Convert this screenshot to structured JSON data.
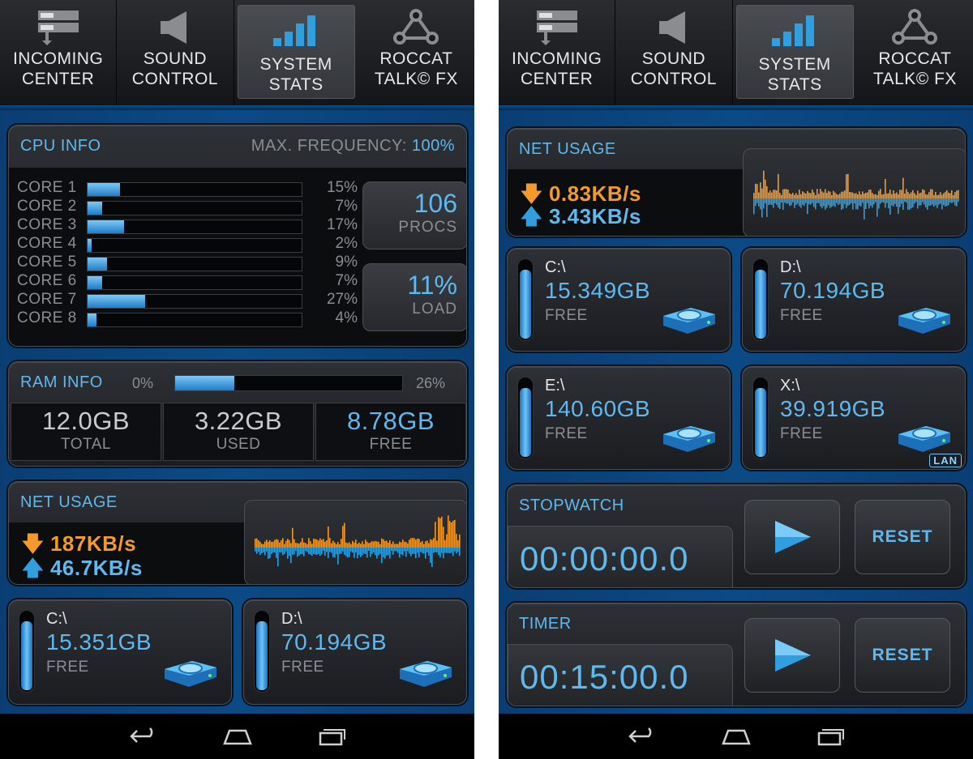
{
  "tabs": [
    {
      "line1": "INCOMING",
      "line2": "CENTER",
      "icon": "server-icon"
    },
    {
      "line1": "SOUND",
      "line2": "CONTROL",
      "icon": "speaker-icon"
    },
    {
      "line1": "SYSTEM",
      "line2": "STATS",
      "icon": "bar-chart-icon",
      "active": true
    },
    {
      "line1": "ROCCAT",
      "line2": "TALK© FX",
      "icon": "network-nodes-icon"
    }
  ],
  "left": {
    "cpu": {
      "title": "CPU INFO",
      "freq_label": "MAX. FREQUENCY:",
      "freq_value": "100%",
      "cores": [
        {
          "name": "CORE 1",
          "pct_text": "15%",
          "value": 15
        },
        {
          "name": "CORE 2",
          "pct_text": "7%",
          "value": 7
        },
        {
          "name": "CORE 3",
          "pct_text": "17%",
          "value": 17
        },
        {
          "name": "CORE 4",
          "pct_text": "2%",
          "value": 2
        },
        {
          "name": "CORE 5",
          "pct_text": "9%",
          "value": 9
        },
        {
          "name": "CORE 6",
          "pct_text": "7%",
          "value": 7
        },
        {
          "name": "CORE 7",
          "pct_text": "27%",
          "value": 27
        },
        {
          "name": "CORE 8",
          "pct_text": "4%",
          "value": 4
        }
      ],
      "procs_value": "106",
      "procs_label": "PROCS",
      "load_value": "11%",
      "load_label": "LOAD"
    },
    "ram": {
      "title": "RAM INFO",
      "min_label": "0%",
      "usage_text": "26%",
      "usage_value": 26,
      "total_value": "12.0GB",
      "total_label": "TOTAL",
      "used_value": "3.22GB",
      "used_label": "USED",
      "free_value": "8.78GB",
      "free_label": "FREE"
    },
    "net": {
      "title": "NET USAGE",
      "down": "187KB/s",
      "up": "46.7KB/s"
    },
    "drives": [
      {
        "name": "C:\\",
        "size": "15.351GB",
        "label": "FREE",
        "level": 0.85
      },
      {
        "name": "D:\\",
        "size": "70.194GB",
        "label": "FREE",
        "level": 0.85
      }
    ]
  },
  "right": {
    "net": {
      "title": "NET USAGE",
      "down": "0.83KB/s",
      "up": "3.43KB/s"
    },
    "drives": [
      {
        "name": "C:\\",
        "size": "15.349GB",
        "label": "FREE",
        "level": 0.85
      },
      {
        "name": "D:\\",
        "size": "70.194GB",
        "label": "FREE",
        "level": 0.85
      },
      {
        "name": "E:\\",
        "size": "140.60GB",
        "label": "FREE",
        "level": 0.85
      },
      {
        "name": "X:\\",
        "size": "39.919GB",
        "label": "FREE",
        "level": 0.85,
        "badge": "LAN"
      }
    ],
    "stopwatch": {
      "title": "STOPWATCH",
      "time": "00:00:00.0",
      "reset": "RESET"
    },
    "timer": {
      "title": "TIMER",
      "time": "00:15:00.0",
      "reset": "RESET"
    }
  },
  "colors": {
    "accent": "#5fb8ee",
    "download": "#f39a2a",
    "upload": "#2f9fe0",
    "background_blue": "#0b4a85"
  }
}
